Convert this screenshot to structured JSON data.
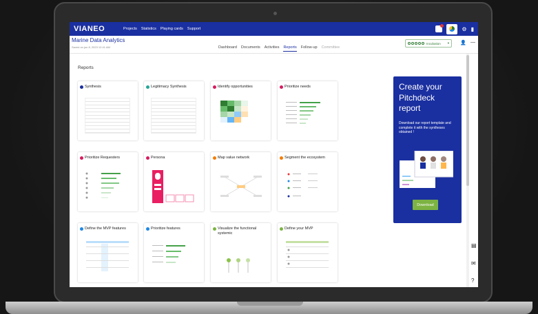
{
  "topbar": {
    "logo": "VIANEO",
    "nav": [
      "Projects",
      "Statistics",
      "Playing cards",
      "Support"
    ]
  },
  "project": {
    "title": "Marine Data Analytics",
    "saved": "Saved on jun 8, 2023 12:41 AM"
  },
  "tabs": [
    {
      "label": "Dashboard",
      "state": "normal"
    },
    {
      "label": "Documents",
      "state": "normal"
    },
    {
      "label": "Activities",
      "state": "normal"
    },
    {
      "label": "Reports",
      "state": "active"
    },
    {
      "label": "Follow-up",
      "state": "normal"
    },
    {
      "label": "Committee",
      "state": "dim"
    }
  ],
  "stage": {
    "label": "Incubation"
  },
  "reports_title": "Reports",
  "cards": [
    {
      "title": "Synthesis",
      "icon": "synthesis-icon",
      "color": "#1a2fa0"
    },
    {
      "title": "Legitimacy Synthesis",
      "icon": "legitimacy-icon",
      "color": "#26a69a"
    },
    {
      "title": "Identify opportunities",
      "icon": "opportunities-icon",
      "color": "#d81b60"
    },
    {
      "title": "Prioritize needs",
      "icon": "needs-icon",
      "color": "#d81b60"
    },
    {
      "title": "Prioritize Requesters",
      "icon": "requesters-icon",
      "color": "#d81b60"
    },
    {
      "title": "Persona",
      "icon": "persona-icon",
      "color": "#d81b60"
    },
    {
      "title": "Map value network",
      "icon": "value-network-icon",
      "color": "#f57c00"
    },
    {
      "title": "Segment the ecosystem",
      "icon": "ecosystem-icon",
      "color": "#f57c00"
    },
    {
      "title": "Define the MVP features",
      "icon": "mvp-features-icon",
      "color": "#1e88e5"
    },
    {
      "title": "Prioritize features",
      "icon": "features-icon",
      "color": "#1e88e5"
    },
    {
      "title": "Visualize the functional systemic",
      "icon": "functional-icon",
      "color": "#7cb342"
    },
    {
      "title": "Define your MVP",
      "icon": "mvp-icon",
      "color": "#7cb342"
    }
  ],
  "promo": {
    "title": "Create your Pitchdeck report",
    "text": "Download our report template and complete it with the syntheses obtained !",
    "button": "Download"
  }
}
